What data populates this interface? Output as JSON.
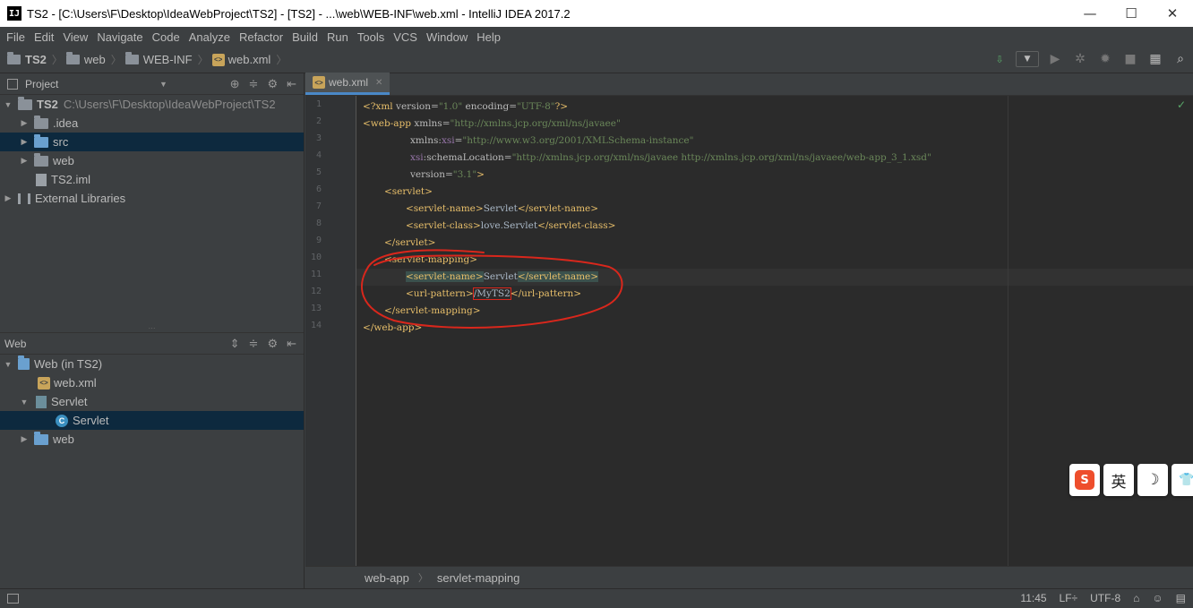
{
  "window": {
    "icon_label": "IJ",
    "title": "TS2 - [C:\\Users\\F\\Desktop\\IdeaWebProject\\TS2] - [TS2] - ...\\web\\WEB-INF\\web.xml - IntelliJ IDEA 2017.2",
    "minimize": "—",
    "maximize": "☐",
    "close": "✕"
  },
  "menu": [
    "File",
    "Edit",
    "View",
    "Navigate",
    "Code",
    "Analyze",
    "Refactor",
    "Build",
    "Run",
    "Tools",
    "VCS",
    "Window",
    "Help"
  ],
  "navbar": {
    "crumbs": [
      "TS2",
      "web",
      "WEB-INF",
      "web.xml"
    ]
  },
  "project_panel": {
    "title": "Project",
    "tree": [
      {
        "label": "TS2",
        "path": "C:\\Users\\F\\Desktop\\IdeaWebProject\\TS2"
      },
      {
        "label": ".idea"
      },
      {
        "label": "src"
      },
      {
        "label": "web"
      },
      {
        "label": "TS2.iml"
      },
      {
        "label": "External Libraries"
      }
    ]
  },
  "web_panel": {
    "title": "Web",
    "tree": [
      {
        "label": "Web (in TS2)"
      },
      {
        "label": "web.xml"
      },
      {
        "label": "Servlet"
      },
      {
        "label": "Servlet"
      },
      {
        "label": "web"
      }
    ]
  },
  "editor": {
    "tab": "web.xml",
    "line_numbers": [
      "1",
      "2",
      "3",
      "4",
      "5",
      "6",
      "7",
      "8",
      "9",
      "10",
      "11",
      "12",
      "13",
      "14"
    ],
    "code": {
      "l1_decl": "<?xml ",
      "l1_attr1": "version=",
      "l1_val1": "\"1.0\"",
      "l1_attr2": " encoding=",
      "l1_val2": "\"UTF-8\"",
      "l1_end": "?>",
      "l2_tag": "<web-app ",
      "l2_attr": "xmlns=",
      "l2_val": "\"http://xmlns.jcp.org/xml/ns/javaee\"",
      "l3_attr": "xmlns:",
      "l3_ns": "xsi",
      "l3_eq": "=",
      "l3_val": "\"http://www.w3.org/2001/XMLSchema-instance\"",
      "l4_ns": "xsi",
      "l4_attr": ":schemaLocation=",
      "l4_val": "\"http://xmlns.jcp.org/xml/ns/javaee http://xmlns.jcp.org/xml/ns/javaee/web-app_3_1.xsd\"",
      "l5_attr": "version=",
      "l5_val": "\"3.1\"",
      "l5_end": ">",
      "l6": "<servlet>",
      "l7_open": "<servlet-name>",
      "l7_text": "Servlet",
      "l7_close": "</servlet-name>",
      "l8_open": "<servlet-class>",
      "l8_text": "love.Servlet",
      "l8_close": "</servlet-class>",
      "l9": "</servlet>",
      "l10": "<servlet-mapping>",
      "l11_open": "<servlet-name>",
      "l11_text": "Servlet",
      "l11_close": "</servlet-name>",
      "l12_open": "<url-pattern>",
      "l12_text": "/MyTS2",
      "l12_close": "</url-pattern>",
      "l13": "</servlet-mapping>",
      "l14": "</web-app>"
    },
    "breadcrumb": [
      "web-app",
      "servlet-mapping"
    ]
  },
  "status": {
    "position": "11:45",
    "line_sep": "LF÷",
    "encoding": "UTF-8"
  },
  "ime": {
    "logo": "S",
    "lang": "英",
    "moon": "☽",
    "shirt": "👕"
  },
  "colors": {
    "tag": "#e8bf6a",
    "value": "#6a8759",
    "selection": "#0d293e",
    "annotation": "#d9271c"
  }
}
